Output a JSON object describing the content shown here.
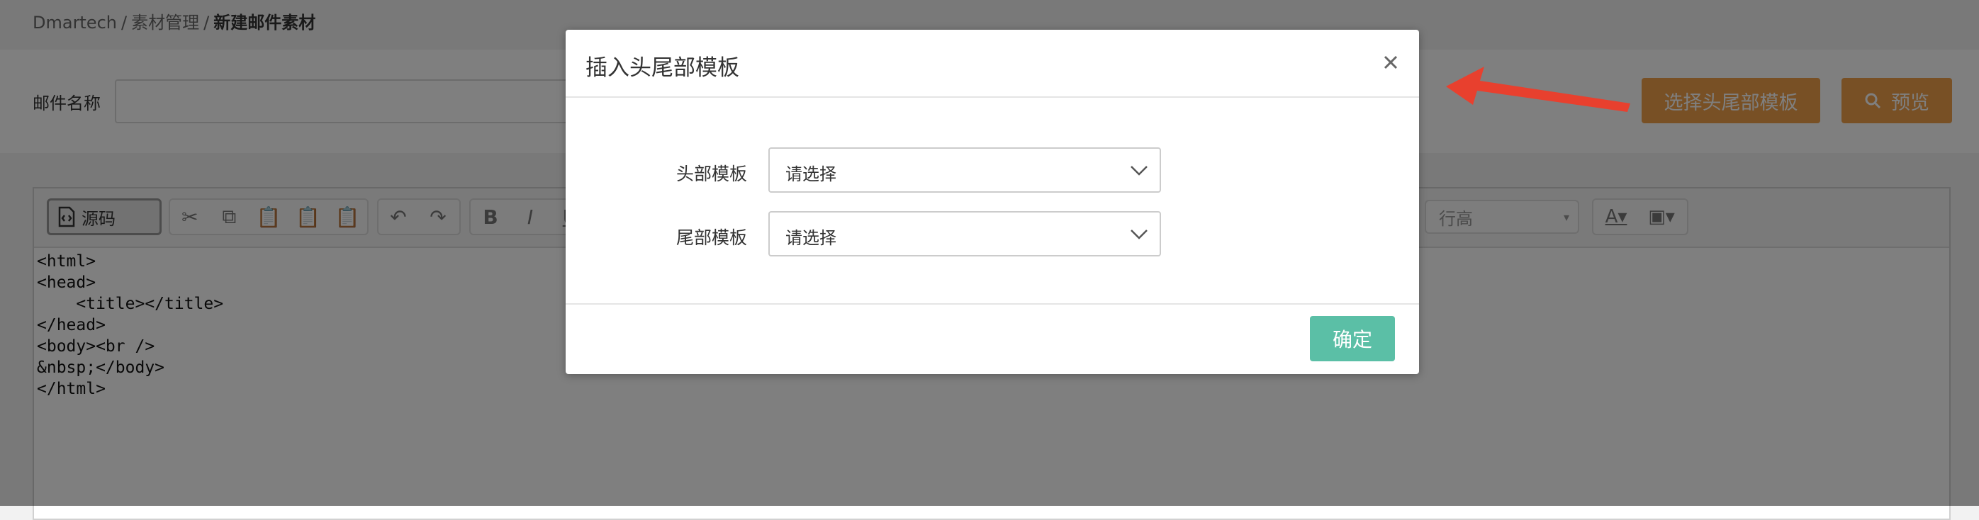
{
  "breadcrumb": {
    "root": "Dmartech",
    "sep": "/",
    "section": "素材管理",
    "current": "新建邮件素材"
  },
  "form": {
    "name_label": "邮件名称",
    "name_value": ""
  },
  "actions": {
    "select_template": "选择头尾部模板",
    "preview": "预览"
  },
  "toolbar": {
    "source_label": "源码",
    "line_height_label": "行高"
  },
  "editor": {
    "code": "<html>\n<head>\n    <title></title>\n</head>\n<body><br />\n&nbsp;</body>\n</html>"
  },
  "modal": {
    "title": "插入头尾部模板",
    "header_label": "头部模板",
    "header_value": "请选择",
    "footer_label": "尾部模板",
    "footer_value": "请选择",
    "ok_label": "确定"
  },
  "colors": {
    "orange": "#f0a04b",
    "teal": "#5bbfa6",
    "arrow": "#e8402e"
  }
}
